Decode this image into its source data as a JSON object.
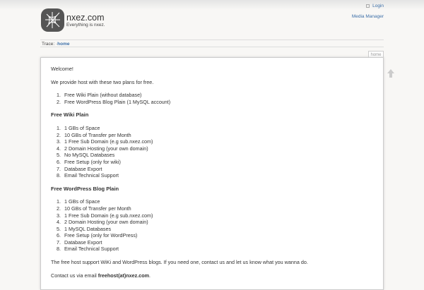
{
  "header": {
    "title": "nxez.com",
    "tagline": "Everything is nxez.",
    "login": "Login",
    "media_manager": "Media Manager"
  },
  "trace": {
    "label": "Trace:",
    "sep": "·",
    "crumb": "home"
  },
  "page_tab": "home",
  "content": {
    "welcome": "Welcome!",
    "intro": "We provide host with these two plans for free.",
    "plans": [
      "Free Wiki Plain (without database)",
      "Free WordPress Blog Plain (1 MySQL account)"
    ],
    "wiki_heading": "Free Wiki Plain",
    "wiki_items": [
      "1 GBs of Space",
      "10 GBs of Transfer per Month",
      "1 Free Sub Domain (e.g sub.nxez.com)",
      "2 Domain Hosting (your own domain)",
      "No MySQL Databases",
      "Free Setup (only for wiki)",
      "Database Export",
      "Email Technical Support"
    ],
    "wp_heading": "Free WordPress Blog Plain",
    "wp_items": [
      "1 GBs of Space",
      "10 GBs of Transfer per Month",
      "1 Free Sub Domain (e.g sub.nxez.com)",
      "2 Domain Hosting (your own domain)",
      "1 MySQL Databases",
      "Free Setup (only for WordPress)",
      "Database Export",
      "Email Technical Support"
    ],
    "support": "The free host support WiKi and WordPress blogs. If you need one, contact us and let us know what you wanna do.",
    "contact_prefix": "Contact us via email ",
    "contact_email": "freehost(at)nxez.com",
    "contact_suffix": "."
  }
}
